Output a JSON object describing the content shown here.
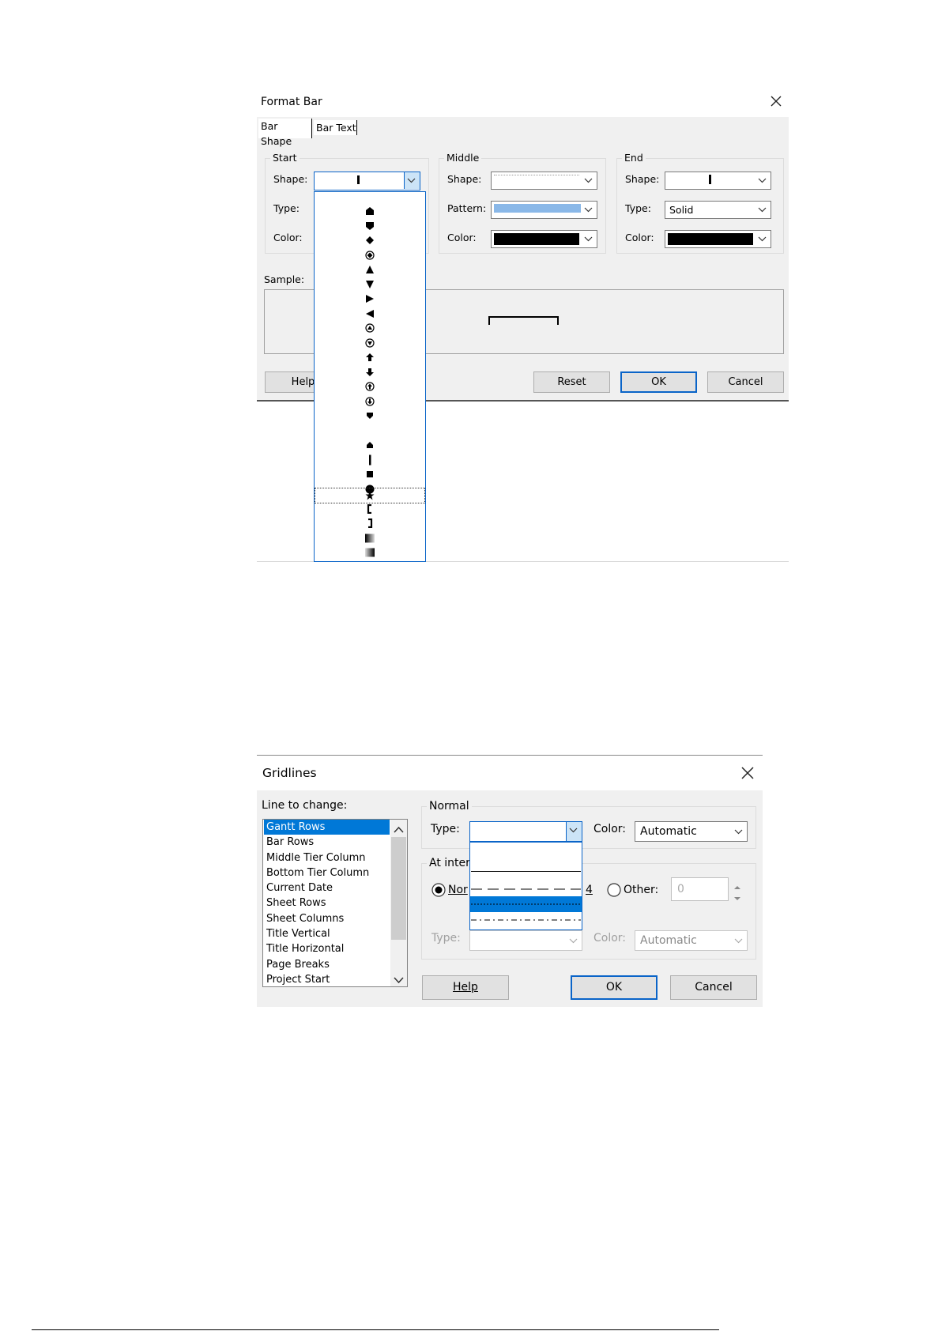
{
  "format_bar": {
    "title": "Format Bar",
    "tabs": [
      "Bar Shape",
      "Bar Text"
    ],
    "start": {
      "group": "Start",
      "shape_label": "Shape:",
      "type_label": "Type:",
      "color_label": "Color:"
    },
    "middle": {
      "group": "Middle",
      "shape_label": "Shape:",
      "pattern_label": "Pattern:",
      "color_label": "Color:",
      "pattern_color": "#8ab8e8",
      "color_value": "#000000"
    },
    "end": {
      "group": "End",
      "shape_label": "Shape:",
      "type_label": "Type:",
      "type_value": "Solid",
      "color_label": "Color:",
      "color_value": "#000000"
    },
    "sample_label": "Sample:",
    "buttons": {
      "help": "Help",
      "reset": "Reset",
      "ok": "OK",
      "cancel": "Cancel"
    },
    "shape_options": [
      "house-up",
      "house-down",
      "diamond",
      "circle-diamond",
      "triangle-up",
      "triangle-down",
      "triangle-right",
      "triangle-left",
      "circle-triangle-up",
      "circle-triangle-down",
      "arrow-up",
      "arrow-down",
      "circle-arrow-up",
      "circle-arrow-down",
      "small-house-down",
      "none",
      "small-house-up",
      "thin-line",
      "square",
      "circle",
      "star",
      "bracket-left",
      "bracket-right",
      "gradient-left",
      "gradient-right"
    ],
    "selected_shape": "star"
  },
  "gridlines": {
    "title": "Gridlines",
    "line_to_change_label": "Line to change:",
    "lines": [
      "Gantt Rows",
      "Bar Rows",
      "Middle Tier Column",
      "Bottom Tier Column",
      "Current Date",
      "Sheet Rows",
      "Sheet Columns",
      "Title Vertical",
      "Title Horizontal",
      "Page Breaks",
      "Project Start"
    ],
    "selected_line": "Gantt Rows",
    "normal_group": "Normal",
    "type_label": "Type:",
    "color_label": "Color:",
    "color_value": "Automatic",
    "interval_group": "At inter",
    "none_label": "Nor",
    "four_label": "4",
    "other_label": "Other:",
    "other_value": "0",
    "type2_label": "Type:",
    "color2_label": "Color:",
    "color2_value": "Automatic",
    "line_types": [
      "none",
      "solid",
      "long-dash",
      "dotted",
      "dash-dot"
    ],
    "selected_type": "dotted",
    "buttons": {
      "help": "Help",
      "ok": "OK",
      "cancel": "Cancel"
    },
    "accent": "#0078d7"
  }
}
